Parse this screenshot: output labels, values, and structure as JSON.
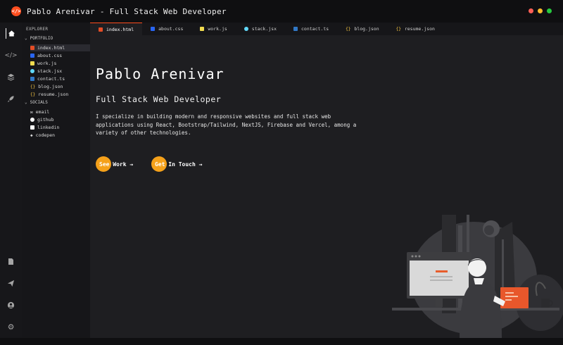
{
  "window": {
    "title": "Pablo Arenivar - Full Stack Web Developer",
    "logo_glyph": "</>",
    "controls": [
      {
        "name": "close",
        "color": "#ff5f56"
      },
      {
        "name": "minimize",
        "color": "#ffbd2e"
      },
      {
        "name": "maximize",
        "color": "#27c93f"
      }
    ]
  },
  "activity_bar": {
    "top": [
      {
        "name": "home-icon",
        "glyph": "⌂"
      },
      {
        "name": "code-icon",
        "glyph": "</>"
      },
      {
        "name": "stack-icon",
        "glyph": "☰"
      },
      {
        "name": "rocket-icon",
        "glyph": "➶"
      }
    ],
    "bottom": [
      {
        "name": "file-icon",
        "glyph": "▤"
      },
      {
        "name": "send-icon",
        "glyph": "➤"
      },
      {
        "name": "user-icon",
        "glyph": "◉"
      },
      {
        "name": "gear-icon",
        "glyph": "⚙"
      }
    ]
  },
  "explorer": {
    "title": "EXPLORER",
    "portfolio": {
      "label": "PORTFOLIO",
      "items": [
        {
          "label": "index.html",
          "icon": "html-icon",
          "color": "#e44d26"
        },
        {
          "label": "about.css",
          "icon": "css-icon",
          "color": "#2965f1"
        },
        {
          "label": "work.js",
          "icon": "js-icon",
          "color": "#f0db4f"
        },
        {
          "label": "stack.jsx",
          "icon": "react-icon",
          "color": "#61dafb"
        },
        {
          "label": "contact.ts",
          "icon": "ts-icon",
          "color": "#3178c6"
        },
        {
          "label": "blog.json",
          "icon": "json-icon",
          "color": "#f5c542"
        },
        {
          "label": "resume.json",
          "icon": "json-icon",
          "color": "#f5c542"
        }
      ]
    },
    "socials": {
      "label": "SOCIALS",
      "items": [
        {
          "label": "email",
          "icon": "mail-icon"
        },
        {
          "label": "github",
          "icon": "github-icon"
        },
        {
          "label": "linkedin",
          "icon": "linkedin-icon"
        },
        {
          "label": "codepen",
          "icon": "codepen-icon"
        }
      ]
    }
  },
  "tabs": [
    {
      "label": "index.html",
      "color": "#e44d26"
    },
    {
      "label": "about.css",
      "color": "#2965f1"
    },
    {
      "label": "work.js",
      "color": "#f0db4f"
    },
    {
      "label": "stack.jsx",
      "color": "#61dafb"
    },
    {
      "label": "contact.ts",
      "color": "#3178c6"
    },
    {
      "label": "blog.json",
      "color": "#f5c542"
    },
    {
      "label": "resume.json",
      "color": "#f5c542"
    }
  ],
  "hero": {
    "name": "Pablo Arenivar",
    "role": "Full Stack Web Developer",
    "description": "I specialize in building modern and responsive websites and full stack web applications using React, Bootstrap/Tailwind, NextJS, Firebase and Vercel, among a variety of other technologies.",
    "cta_work": "See Work →",
    "cta_contact": "Get In Touch →",
    "accent": "#f5a11a"
  }
}
